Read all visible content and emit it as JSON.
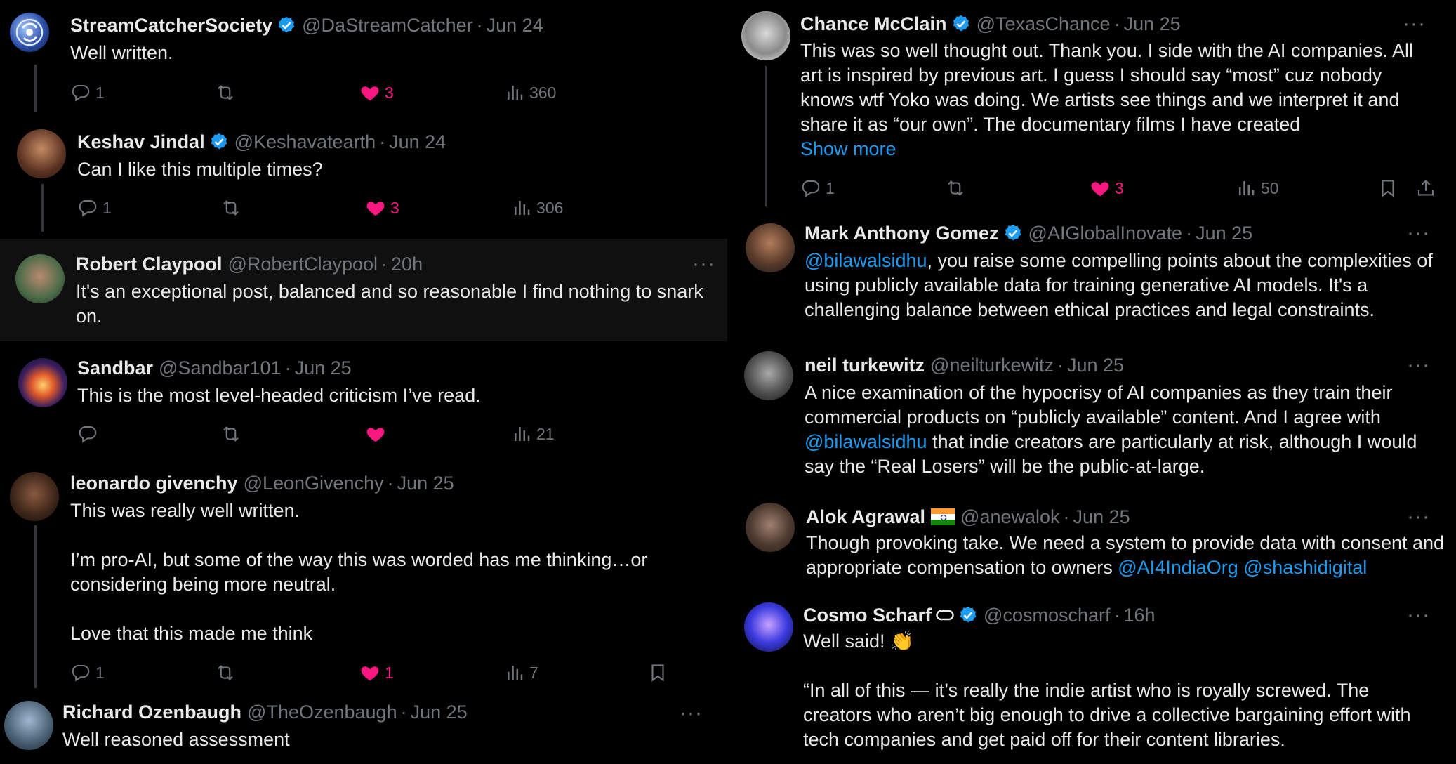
{
  "left": [
    {
      "name": "StreamCatcherSociety",
      "handle": "@DaStreamCatcher",
      "time": "Jun 24",
      "text": [
        "Well written."
      ],
      "replies": "1",
      "likes": "3",
      "views": "360"
    },
    {
      "name": "Keshav Jindal",
      "handle": "@Keshavatearth",
      "time": "Jun 24",
      "text": [
        "Can I like this multiple times?"
      ],
      "replies": "1",
      "likes": "3",
      "views": "306"
    },
    {
      "name": "Robert Claypool",
      "handle": "@RobertClaypool",
      "time": "20h",
      "text": [
        "It's an exceptional post, balanced and so reasonable I find nothing to snark",
        "on."
      ]
    },
    {
      "name": "Sandbar",
      "handle": "@Sandbar101",
      "time": "Jun 25",
      "text": [
        "This is the most level-headed criticism I’ve read."
      ],
      "views": "21"
    },
    {
      "name": "leonardo givenchy",
      "handle": "@LeonGivenchy",
      "time": "Jun 25",
      "text": [
        "This was really well written.",
        "",
        "I’m pro-AI, but some of the way this was worded has me thinking…or",
        "considering being more neutral.",
        "",
        "Love that this made me think"
      ],
      "replies": "1",
      "likes": "1",
      "views": "7"
    },
    {
      "name": "Richard Ozenbaugh",
      "handle": "@TheOzenbaugh",
      "time": "Jun 25",
      "text": [
        "Well reasoned assessment"
      ]
    }
  ],
  "right": [
    {
      "name": "Chance McClain",
      "handle": "@TexasChance",
      "time": "Jun 25",
      "text": [
        "This was so well thought out. Thank you. I side with the AI companies. All",
        "art is inspired by previous art. I guess I should say “most” cuz nobody",
        "knows wtf Yoko was doing. We artists see things and we interpret it and",
        "share it as “our own”. The documentary films I have created"
      ],
      "show_more": "Show more",
      "replies": "1",
      "likes": "3",
      "views": "50"
    },
    {
      "name": "Mark Anthony Gomez",
      "handle": "@AIGlobalInovate",
      "time": "Jun 25",
      "mention": "@bilawalsidhu",
      "text_after_mention": ", you raise some compelling points about the complexities of",
      "text": [
        "using publicly available data for training generative AI models. It's a",
        "challenging balance between ethical practices and legal constraints."
      ]
    },
    {
      "name": "neil turkewitz",
      "handle": "@neilturkewitz",
      "time": "Jun 25",
      "text": [
        "A nice examination of the hypocrisy of AI companies as they train their",
        "commercial products on “publicly available” content. And I agree with"
      ],
      "mention": "@bilawalsidhu",
      "text_after_mention": " that indie creators are particularly at risk, although I would",
      "text_end": "say the “Real Losers” will be the public-at-large."
    },
    {
      "name": "Alok Agrawal",
      "handle": "@anewalok",
      "time": "Jun 25",
      "text": [
        "Though provoking take. We need a system to provide data with consent and"
      ],
      "text_before_links": "appropriate compensation to owners ",
      "mention1": "@AI4IndiaOrg",
      "mention2": "@shashidigital"
    },
    {
      "name": "Cosmo Scharf",
      "handle": "@cosmoscharf",
      "time": "16h",
      "text": [
        "Well said! 👏",
        "",
        "“In all of this — it’s really the indie artist who is royally screwed. The",
        "creators who aren’t big enough to drive a collective bargaining effort with",
        "tech companies and get paid off for their content libraries."
      ]
    }
  ],
  "colors": {
    "background": "#000000",
    "text": "#e7e9ea",
    "muted": "#71767b",
    "link": "#1d9bf0",
    "like": "#f91880",
    "verified": "#1d9bf0",
    "highlight": "#101010"
  }
}
